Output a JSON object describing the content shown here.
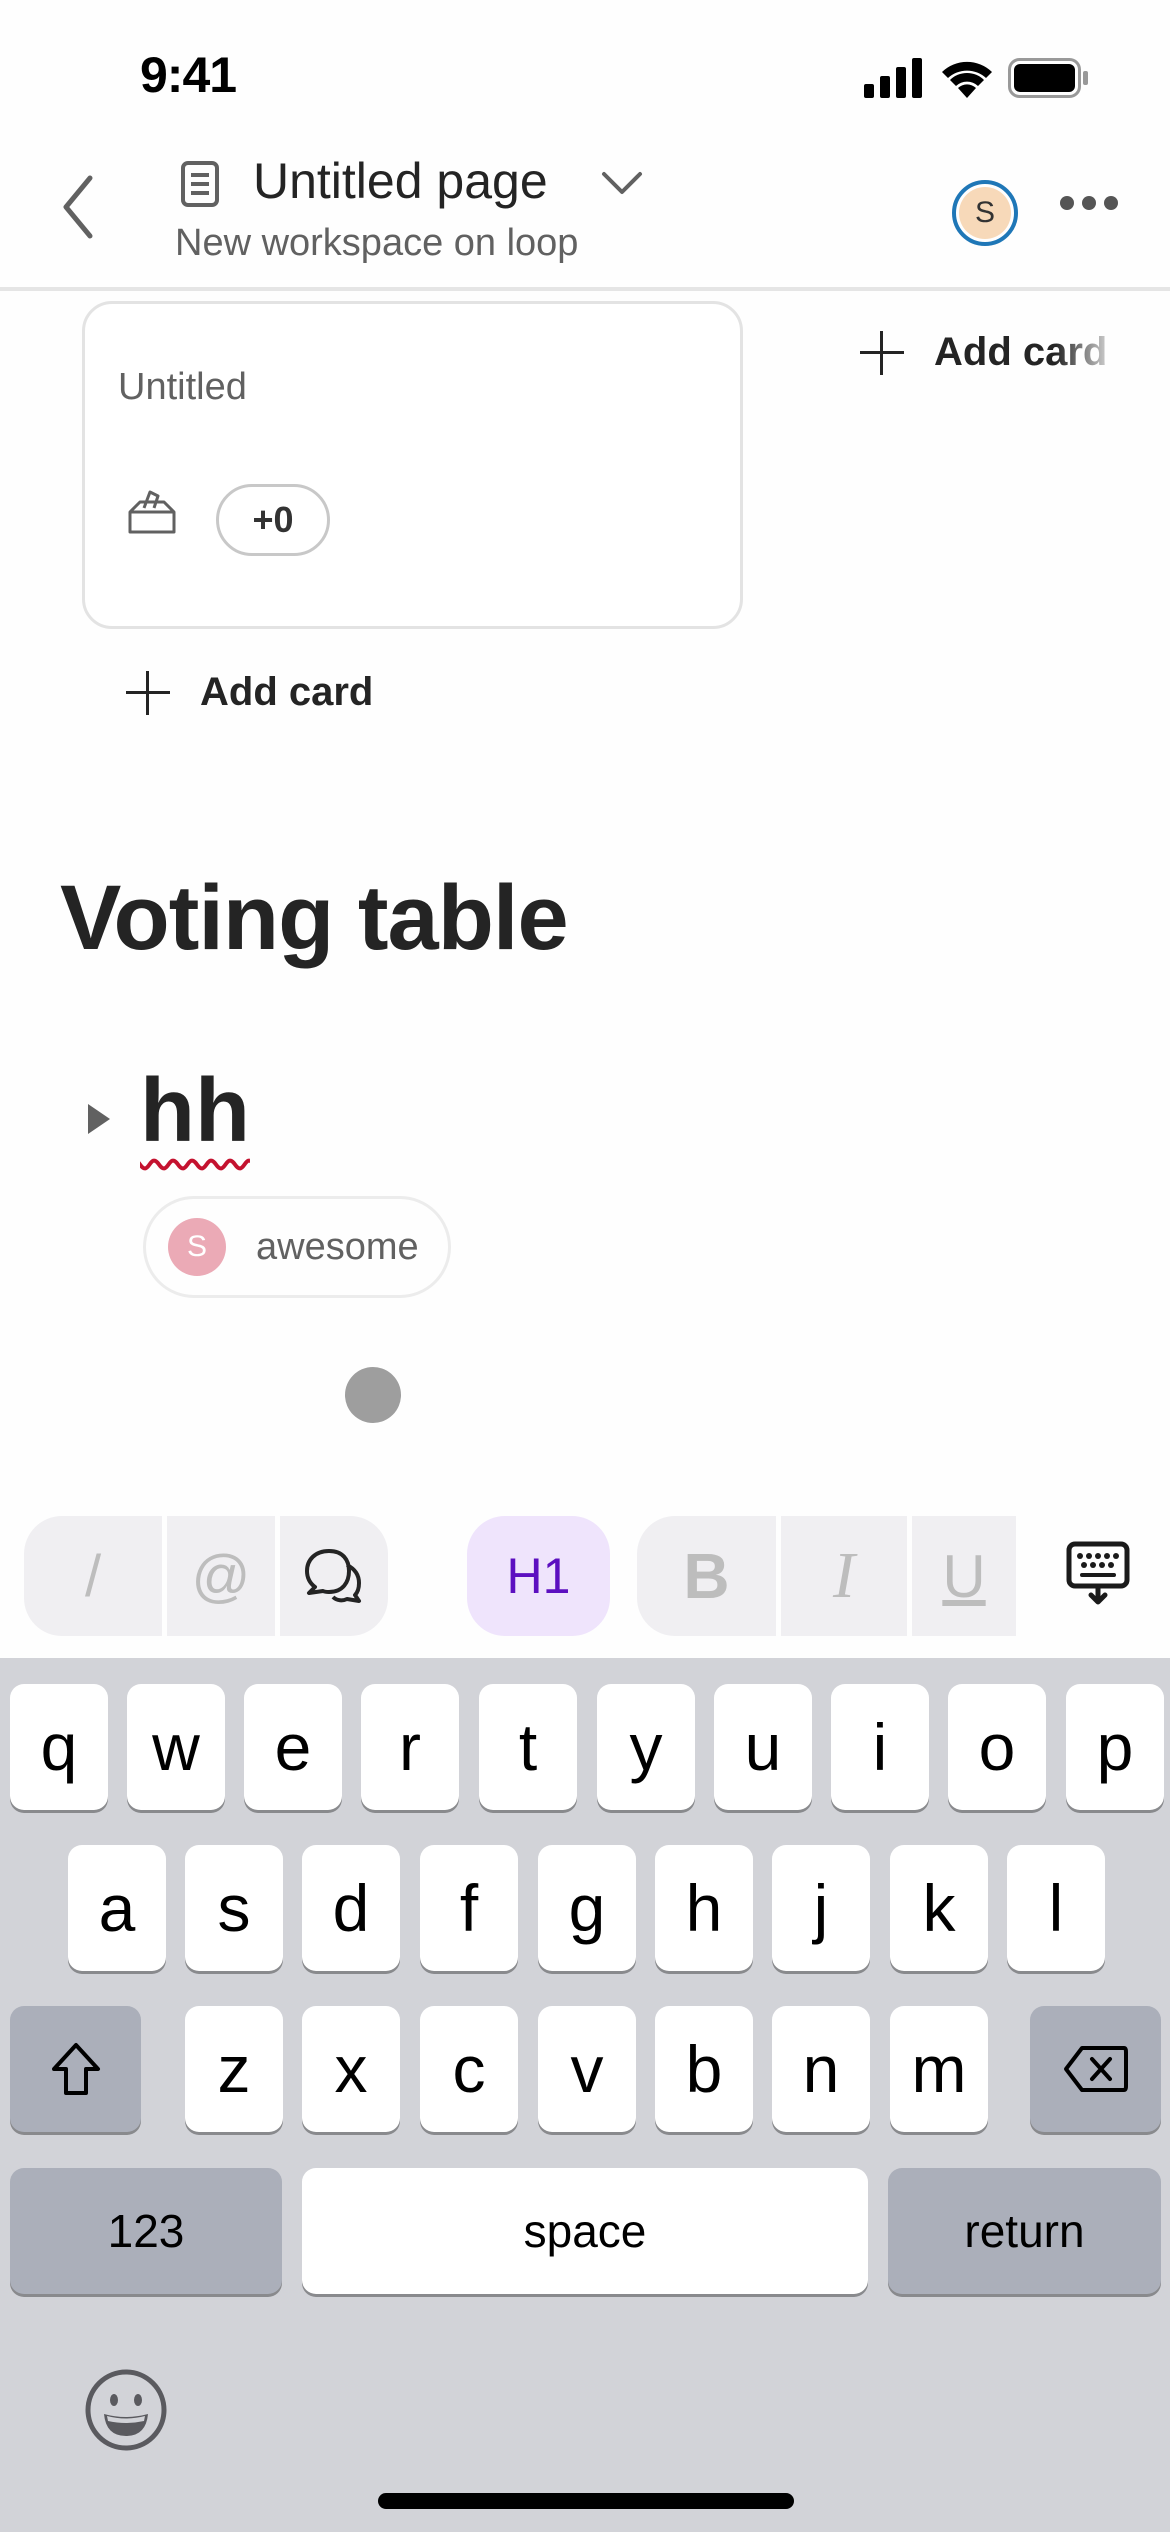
{
  "status_bar": {
    "time": "9:41",
    "icons": [
      "cellular-signal-icon",
      "wifi-icon",
      "battery-icon"
    ]
  },
  "header": {
    "back_icon": "chevron-left-icon",
    "page_icon": "document-icon",
    "title": "Untitled page",
    "title_chevron": "chevron-down-icon",
    "subtitle": "New workspace on loop",
    "avatar_initial": "S",
    "more_icon": "ellipsis-icon",
    "colors": {
      "avatar_ring": "#1f77b7",
      "avatar_fill": "#f7d9b9"
    }
  },
  "board": {
    "card": {
      "title": "Untitled",
      "vote_icon": "ballot-box-icon",
      "vote_count": "+0"
    },
    "add_card_left": "Add card",
    "add_card_right": "Add card"
  },
  "section": {
    "title": "Voting table"
  },
  "voting_item": {
    "title": "hh",
    "spellcheck_underline_color": "#c4122f",
    "votes": [
      {
        "avatar_initial": "S",
        "label": "awesome",
        "avatar_color": "#ebaab6"
      }
    ]
  },
  "format_toolbar": {
    "buttons": [
      {
        "name": "slash-command",
        "glyph": "/"
      },
      {
        "name": "mention",
        "glyph": "@"
      },
      {
        "name": "comment",
        "icon": "comment-icon"
      },
      {
        "name": "heading-1",
        "glyph": "H1",
        "active": true
      },
      {
        "name": "bold",
        "glyph": "B"
      },
      {
        "name": "italic",
        "glyph": "I"
      },
      {
        "name": "underline",
        "glyph": "U"
      }
    ],
    "dismiss_icon": "keyboard-dismiss-icon",
    "active_color": "#5c0fc0",
    "active_bg": "#efe4fc"
  },
  "keyboard": {
    "row1": [
      "q",
      "w",
      "e",
      "r",
      "t",
      "y",
      "u",
      "i",
      "o",
      "p"
    ],
    "row2": [
      "a",
      "s",
      "d",
      "f",
      "g",
      "h",
      "j",
      "k",
      "l"
    ],
    "row3": [
      "z",
      "x",
      "c",
      "v",
      "b",
      "n",
      "m"
    ],
    "shift_icon": "shift-icon",
    "delete_icon": "backspace-icon",
    "numbers_label": "123",
    "space_label": "space",
    "return_label": "return",
    "emoji_icon": "emoji-icon"
  }
}
